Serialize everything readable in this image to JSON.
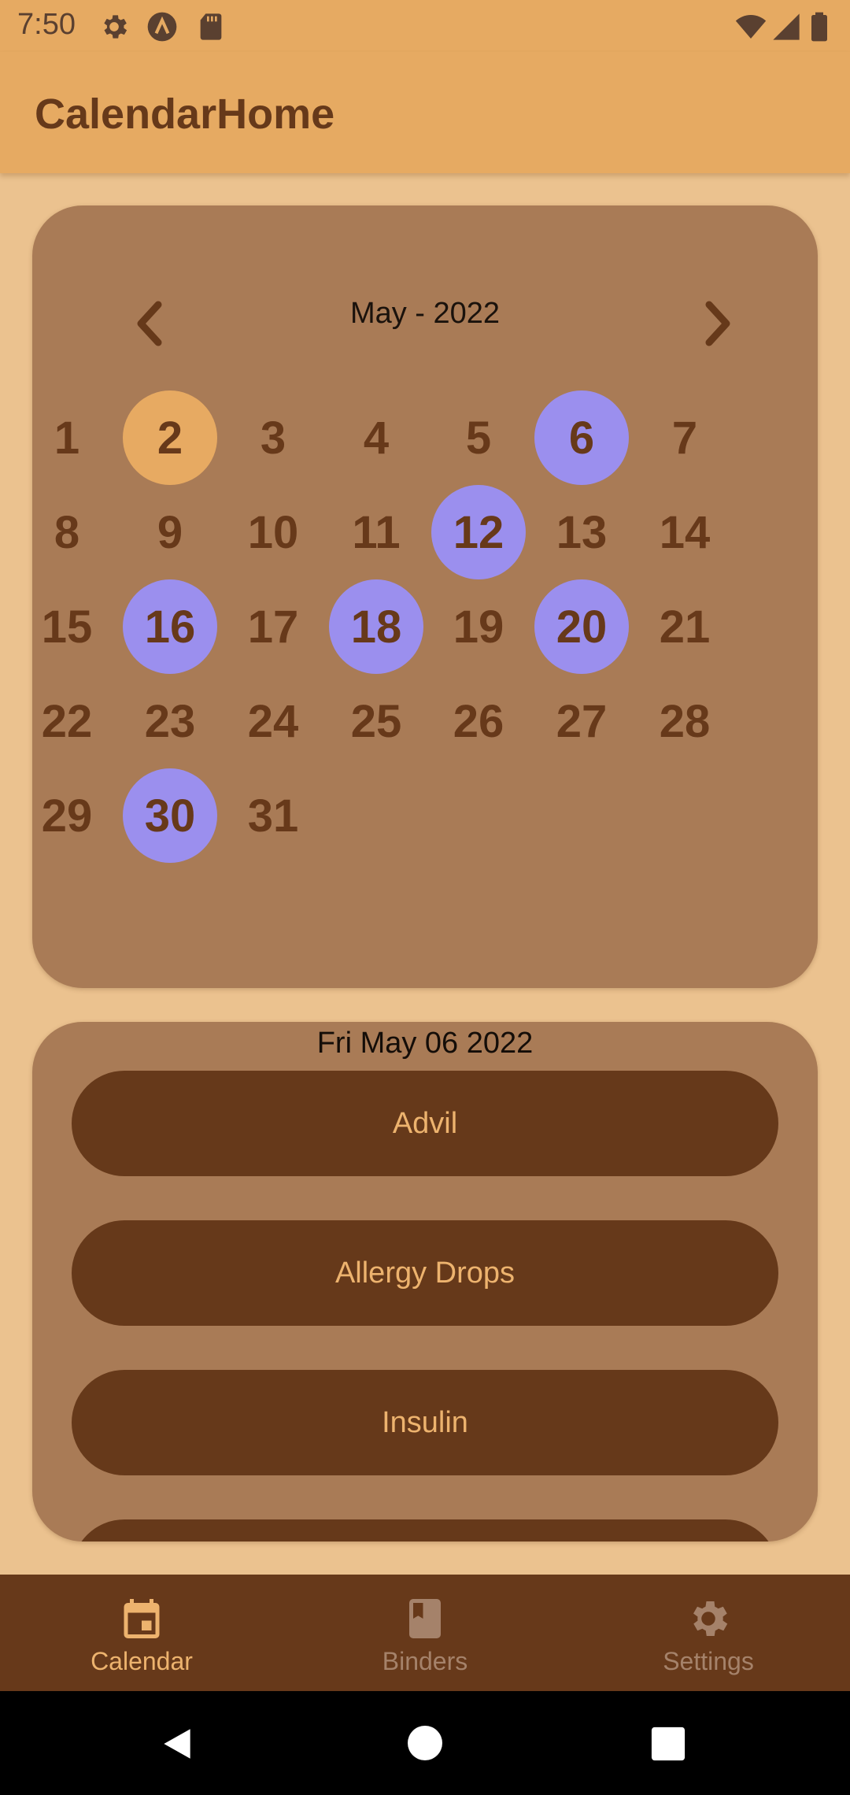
{
  "status_bar": {
    "time": "7:50",
    "left_icons": [
      "gear-icon",
      "app-a-icon",
      "sd-card-icon"
    ],
    "right_icons": [
      "wifi-icon",
      "signal-icon",
      "battery-icon"
    ]
  },
  "app_bar": {
    "title": "CalendarHome"
  },
  "calendar": {
    "month_label": "May - 2022",
    "days": [
      {
        "label": "1",
        "state": "normal"
      },
      {
        "label": "2",
        "state": "today"
      },
      {
        "label": "3",
        "state": "normal"
      },
      {
        "label": "4",
        "state": "normal"
      },
      {
        "label": "5",
        "state": "normal"
      },
      {
        "label": "6",
        "state": "marked"
      },
      {
        "label": "7",
        "state": "normal"
      },
      {
        "label": "8",
        "state": "normal"
      },
      {
        "label": "9",
        "state": "normal"
      },
      {
        "label": "10",
        "state": "normal"
      },
      {
        "label": "11",
        "state": "normal"
      },
      {
        "label": "12",
        "state": "marked"
      },
      {
        "label": "13",
        "state": "normal"
      },
      {
        "label": "14",
        "state": "normal"
      },
      {
        "label": "15",
        "state": "normal"
      },
      {
        "label": "16",
        "state": "marked"
      },
      {
        "label": "17",
        "state": "normal"
      },
      {
        "label": "18",
        "state": "marked"
      },
      {
        "label": "19",
        "state": "normal"
      },
      {
        "label": "20",
        "state": "marked"
      },
      {
        "label": "21",
        "state": "normal"
      },
      {
        "label": "22",
        "state": "normal"
      },
      {
        "label": "23",
        "state": "normal"
      },
      {
        "label": "24",
        "state": "normal"
      },
      {
        "label": "25",
        "state": "normal"
      },
      {
        "label": "26",
        "state": "normal"
      },
      {
        "label": "27",
        "state": "normal"
      },
      {
        "label": "28",
        "state": "normal"
      },
      {
        "label": "29",
        "state": "normal"
      },
      {
        "label": "30",
        "state": "marked"
      },
      {
        "label": "31",
        "state": "normal"
      }
    ]
  },
  "events": {
    "selected_date": "Fri May 06 2022",
    "items": [
      {
        "label": "Advil"
      },
      {
        "label": "Allergy Drops"
      },
      {
        "label": "Insulin"
      }
    ]
  },
  "bottom_nav": {
    "items": [
      {
        "label": "Calendar",
        "icon": "calendar-icon",
        "active": true
      },
      {
        "label": "Binders",
        "icon": "book-icon",
        "active": false
      },
      {
        "label": "Settings",
        "icon": "gear-icon",
        "active": false
      }
    ]
  },
  "colors": {
    "background": "#EBC28F",
    "app_bar": "#E6AA62",
    "card": "#A97B56",
    "dark_brown": "#67391A",
    "today_highlight": "#E7AA62",
    "marked_highlight": "#9B8FEE",
    "nav_active": "#EDB36E",
    "nav_inactive": "#A5826A"
  }
}
